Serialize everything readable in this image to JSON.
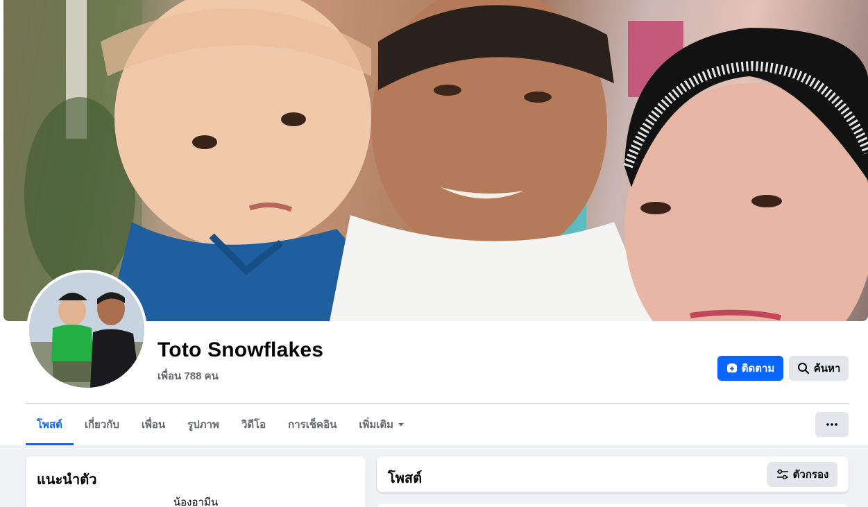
{
  "profile": {
    "name": "Toto Snowflakes",
    "friends": "เพื่อน 788 คน"
  },
  "actions": {
    "follow_label": "ติดตาม",
    "search_label": "ค้นหา"
  },
  "tabs": [
    {
      "label": "โพสต์",
      "active": true
    },
    {
      "label": "เกี่ยวกับ"
    },
    {
      "label": "เพื่อน"
    },
    {
      "label": "รูปภาพ"
    },
    {
      "label": "วิดีโอ"
    },
    {
      "label": "การเช็คอิน"
    },
    {
      "label": "เพิ่มเติม"
    }
  ],
  "intro": {
    "title": "แนะนำตัว",
    "bio": "น้องอามีน"
  },
  "posts": {
    "title": "โพสต์",
    "filter_label": "ตัวกรอง"
  },
  "colors": {
    "accent": "#0866ff",
    "secondary_button": "#e4e6eb",
    "muted_text": "#65676b",
    "feed_background": "#f0f2f5"
  },
  "icons": {
    "follow": "follow-icon",
    "search": "search-icon",
    "more": "more-dots-icon",
    "dropdown": "caret-down-icon",
    "filter": "filter-icon"
  }
}
